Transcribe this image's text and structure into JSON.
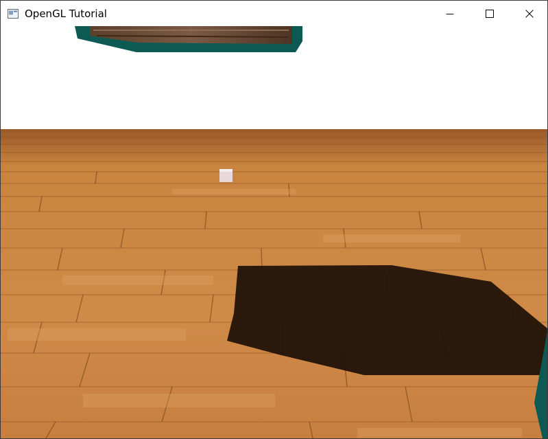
{
  "window": {
    "title": "OpenGL Tutorial",
    "icon": "application-window-icon",
    "controls": {
      "minimize": "minimize-icon",
      "maximize": "maximize-icon",
      "close": "close-icon"
    }
  },
  "scene": {
    "background_color": "#ffffff",
    "floor_color": "#c8833e",
    "floor_dark_color": "#8a4f1f",
    "shadow_color": "#1e1007",
    "container_side_color": "#0d5a55",
    "container_top_color": "#6b4a35",
    "light_cube_color": "#e8d8dc"
  }
}
